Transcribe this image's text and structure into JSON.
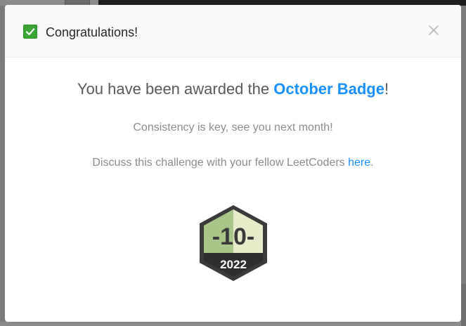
{
  "header": {
    "title": "Congratulations!"
  },
  "body": {
    "headline_prefix": "You have been awarded the ",
    "badge_name": "October Badge",
    "headline_suffix": "!",
    "message": "Consistency is key, see you next month!",
    "discuss_prefix": "Discuss this challenge with your fellow LeetCoders ",
    "discuss_link": "here",
    "discuss_suffix": "."
  },
  "badge": {
    "number": "-10-",
    "year": "2022"
  },
  "colors": {
    "accent": "#1a90ff",
    "check": "#3aa534",
    "badge_light": "#e6ecc9",
    "badge_mid": "#a9c68a",
    "badge_dark": "#3a3a3a"
  }
}
